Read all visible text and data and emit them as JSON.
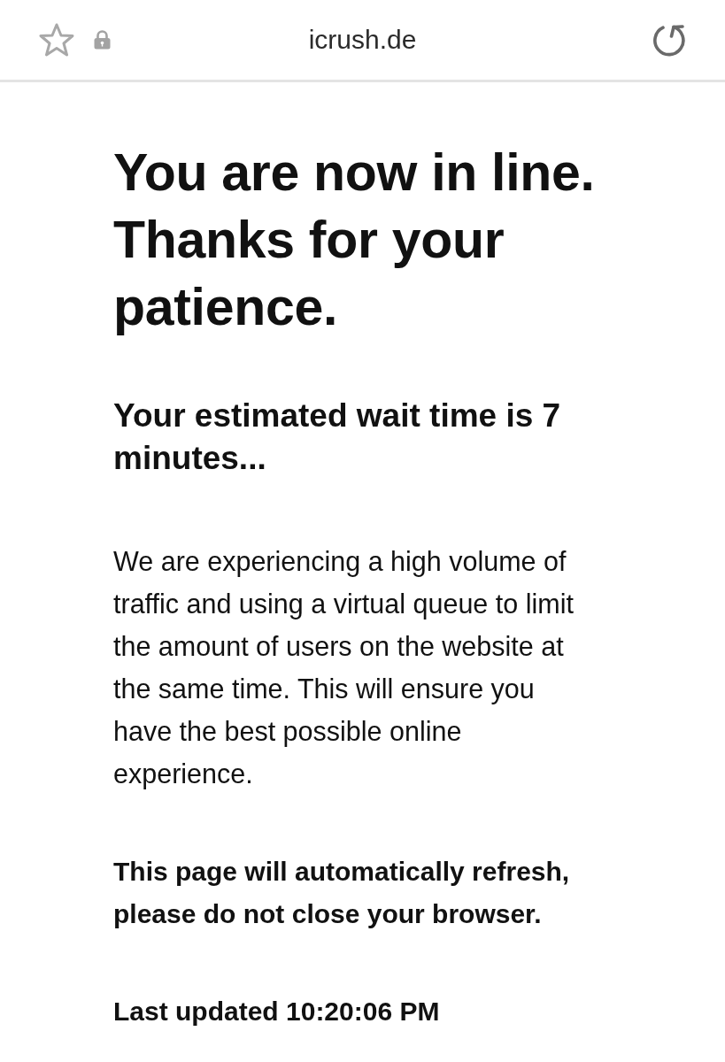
{
  "address_bar": {
    "url": "icrush.de",
    "bookmarked": false
  },
  "page": {
    "heading": "You are now in line. Thanks for your patience.",
    "wait_time": "Your estimated wait time is 7 minutes...",
    "message": "We are experiencing a high volume of traffic and using a virtual queue to limit the amount of users on the website at the same time. This will ensure you have the best possible online experience.",
    "notice": "This page will automatically refresh, please do not close your browser.",
    "last_updated": "Last updated 10:20:06 PM"
  }
}
